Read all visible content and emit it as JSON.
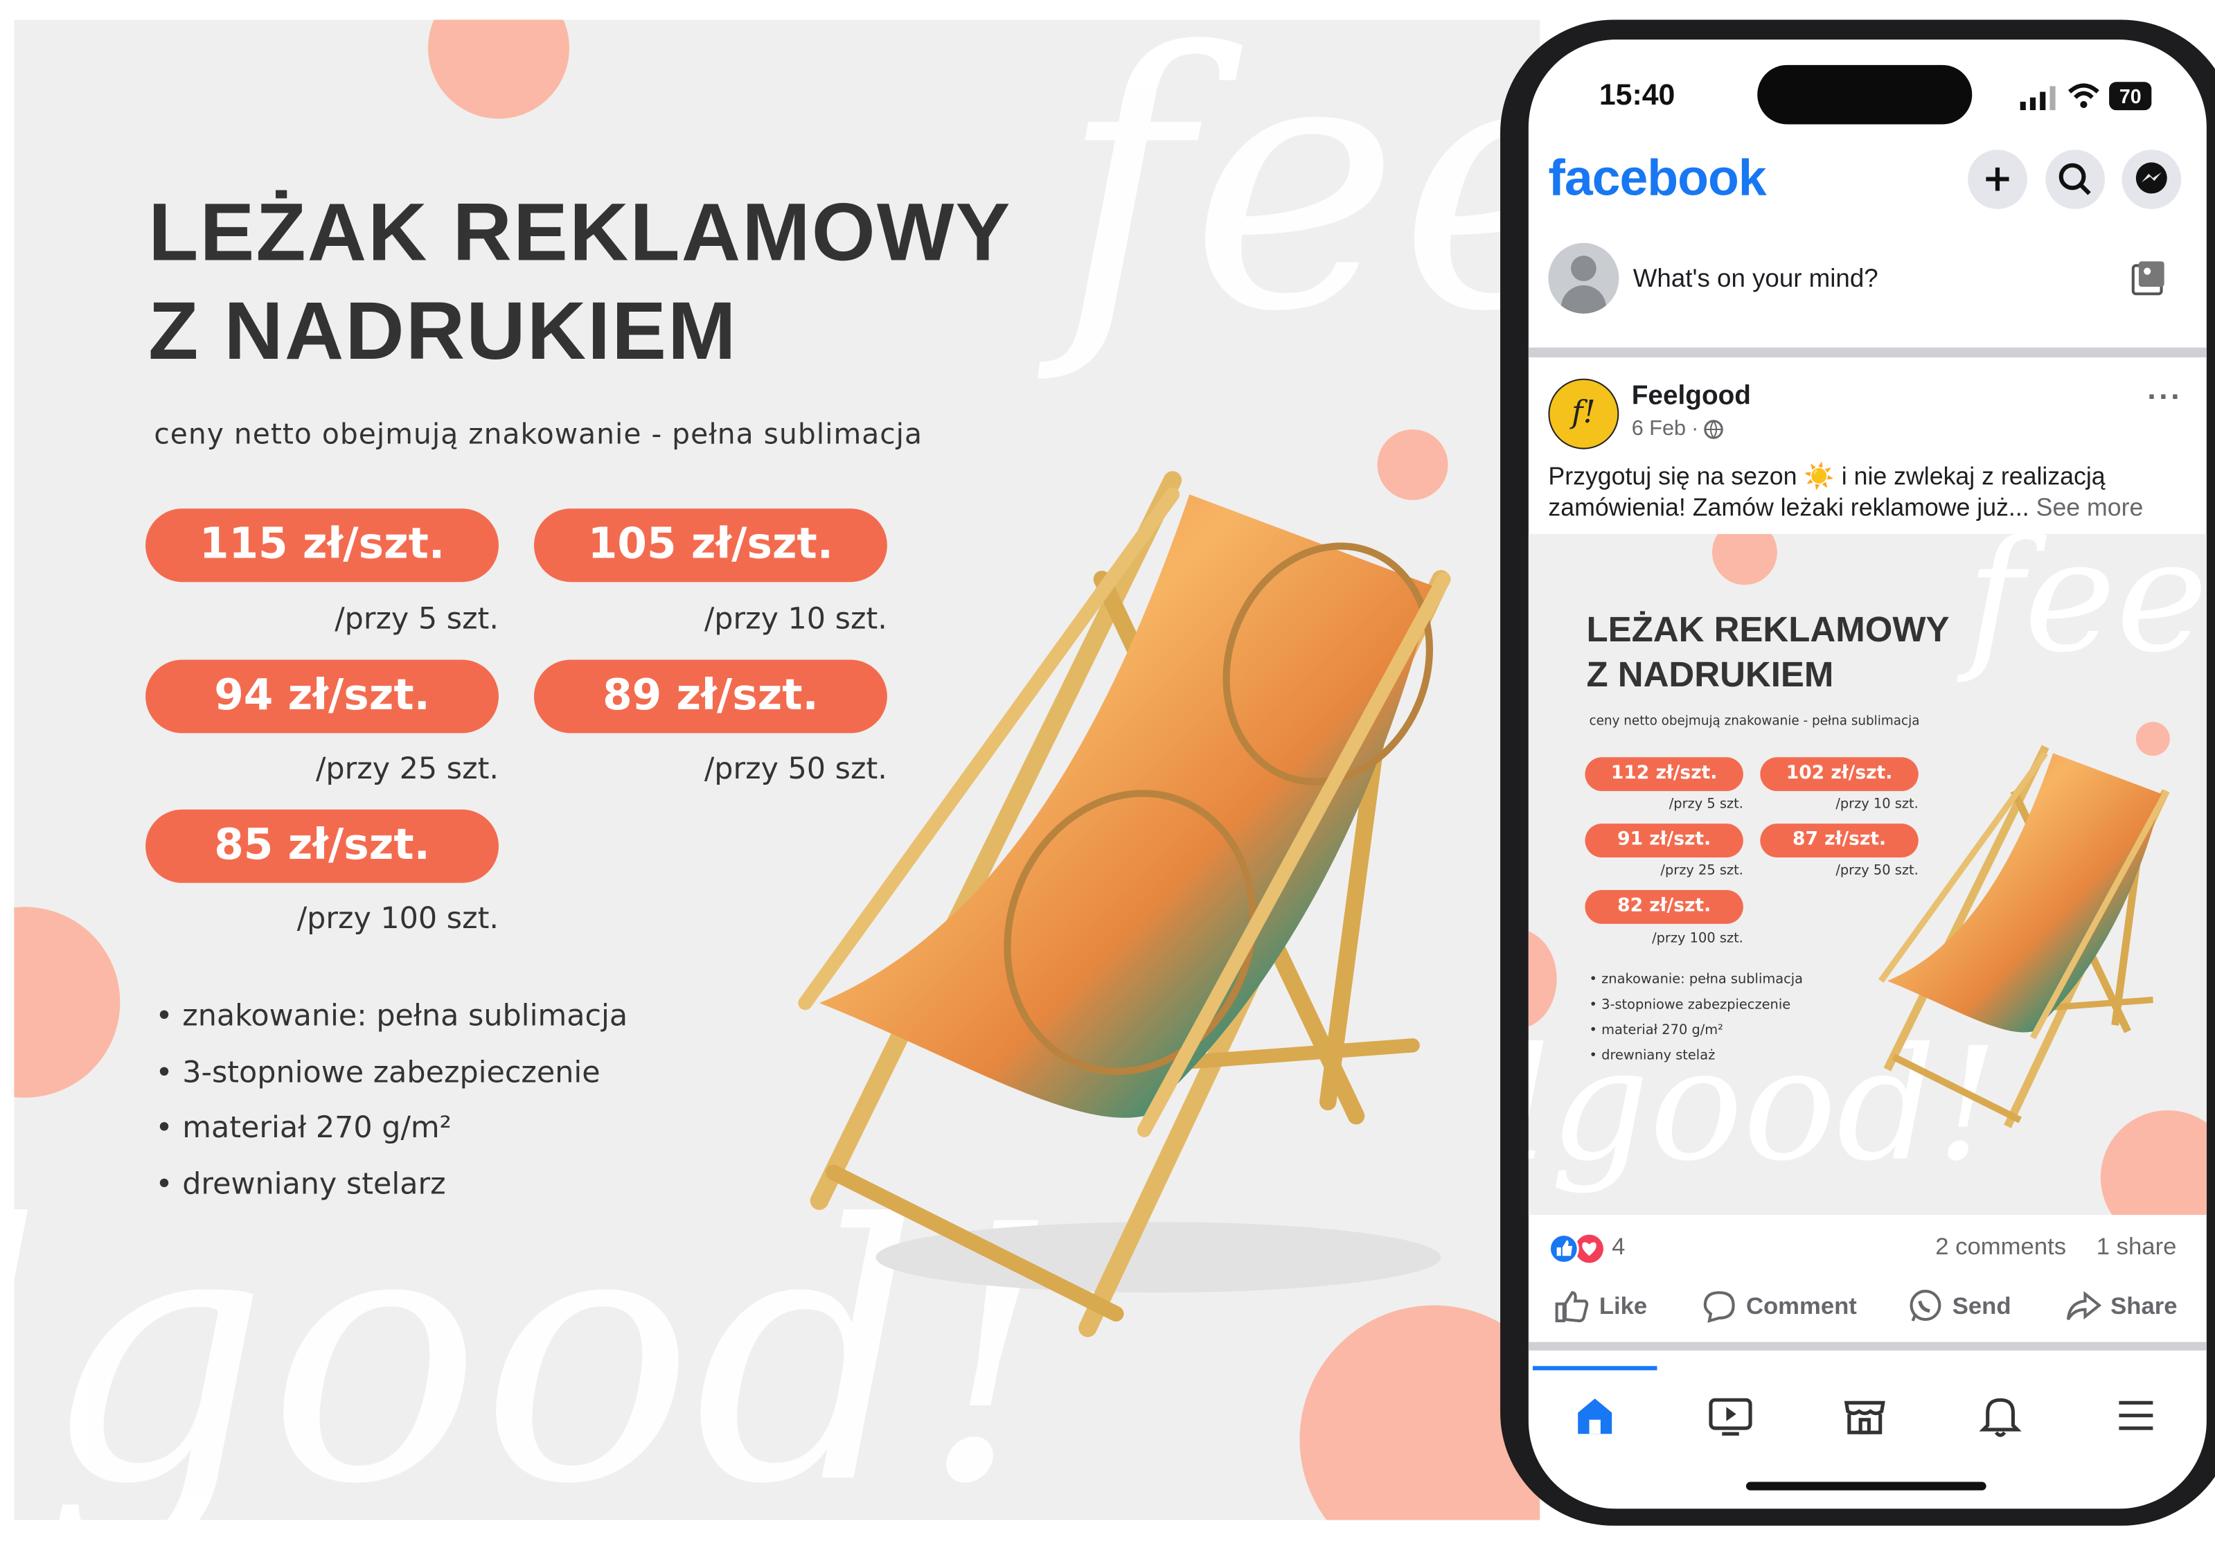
{
  "ad": {
    "headline_line1": "LEŻAK REKLAMOWY",
    "headline_line2": "Z NADRUKIEM",
    "subtitle": "ceny netto obejmują znakowanie - pełna sublimacja",
    "prices": [
      {
        "price": "115 zł/szt.",
        "qty": "/przy 5 szt."
      },
      {
        "price": "105 zł/szt.",
        "qty": "/przy 10 szt."
      },
      {
        "price": "94 zł/szt.",
        "qty": "/przy 25 szt."
      },
      {
        "price": "89 zł/szt.",
        "qty": "/przy 50 szt."
      },
      {
        "price": "85 zł/szt.",
        "qty": "/przy 100 szt."
      }
    ],
    "bullets": [
      "znakowanie: pełna sublimacja",
      "3-stopniowe zabezpieczenie",
      "materiał 270 g/m²",
      "drewniany stelarz"
    ],
    "script_word_top": "feel",
    "script_word_bottom": "lgood!"
  },
  "phone": {
    "status": {
      "time": "15:40",
      "battery": "70"
    },
    "app_logo": "facebook",
    "composer_placeholder": "What's on your mind?",
    "post": {
      "author": "Feelgood",
      "date": "6 Feb",
      "text_line1": "Przygotuj się na sezon ☀️ i nie zwlekaj z realizacją",
      "text_line2": "zamówienia! Zamów leżaki reklamowe już...",
      "see_more": "See more",
      "image": {
        "headline_line1": "LEŻAK REKLAMOWY",
        "headline_line2": "Z NADRUKIEM",
        "subtitle": "ceny netto obejmują znakowanie - pełna sublimacja",
        "prices": [
          {
            "price": "112 zł/szt.",
            "qty": "/przy 5 szt."
          },
          {
            "price": "102 zł/szt.",
            "qty": "/przy 10 szt."
          },
          {
            "price": "91 zł/szt.",
            "qty": "/przy 25 szt."
          },
          {
            "price": "87 zł/szt.",
            "qty": "/przy 50 szt."
          },
          {
            "price": "82 zł/szt.",
            "qty": "/przy 100 szt."
          }
        ],
        "bullets": [
          "znakowanie: pełna sublimacja",
          "3-stopniowe zabezpieczenie",
          "materiał 270 g/m²",
          "drewniany stelaż"
        ],
        "script_word_top": "feel",
        "script_word_bottom": "lgood!"
      },
      "reactions_count": "4",
      "comments": "2 comments",
      "shares": "1 share",
      "actions": {
        "like": "Like",
        "comment": "Comment",
        "send": "Send",
        "share": "Share"
      }
    },
    "colors": {
      "facebook_blue": "#1877f2",
      "price_pill": "#f36b4f",
      "accent_circle": "#fbb8a6"
    }
  }
}
